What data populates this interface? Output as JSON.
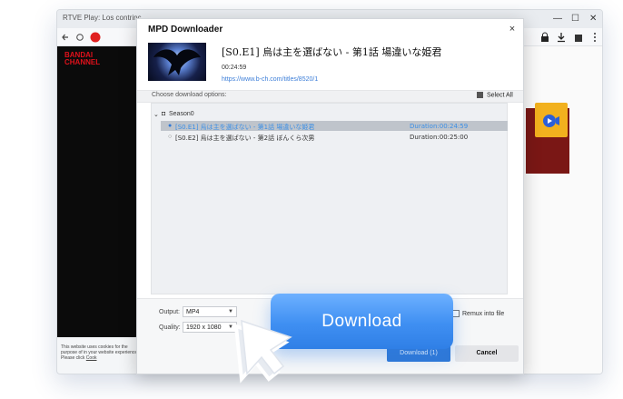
{
  "browser": {
    "tab_title": "RTVE Play: Los contrinc",
    "minimize": "—",
    "maximize": "☐",
    "close": "✕",
    "brand_line1": "BANDAI",
    "brand_line2": "CHANNEL",
    "cookie_notice": "This website uses cookies for the purpose of in your website experience. Please click",
    "cookie_link": "Cook"
  },
  "dialog": {
    "title": "MPD Downloader",
    "close": "×",
    "video_title": "[S0.E1] 烏は主を選ばない - 第1話 場違いな姫君",
    "duration": "00:24:59",
    "url": "https://www.b-ch.com/titles/8520/1",
    "options_label": "Choose download options:",
    "select_all": "Select All",
    "tree": {
      "season": "Season0",
      "episodes": [
        {
          "label": "[S0.E1] 烏は主を選ばない - 第1話 場違いな姫君",
          "duration": "Duration:00:24:59",
          "selected": true
        },
        {
          "label": "[S0.E2] 烏は主を選ばない - 第2話 ぼんくら次男",
          "duration": "Duration:00:25:00",
          "selected": false
        }
      ]
    },
    "output_label": "Output:",
    "output_value": "MP4",
    "quality_label": "Quality:",
    "quality_value": "1920 x 1080",
    "remux_label": "Remux into file",
    "download_button": "Download (1)",
    "cancel_button": "Cancel"
  },
  "overlay": {
    "download_label": "Download"
  },
  "colors": {
    "accent": "#2f78d6",
    "selected_text": "#3a8ee6",
    "overlay_button": "#4a95f4"
  }
}
